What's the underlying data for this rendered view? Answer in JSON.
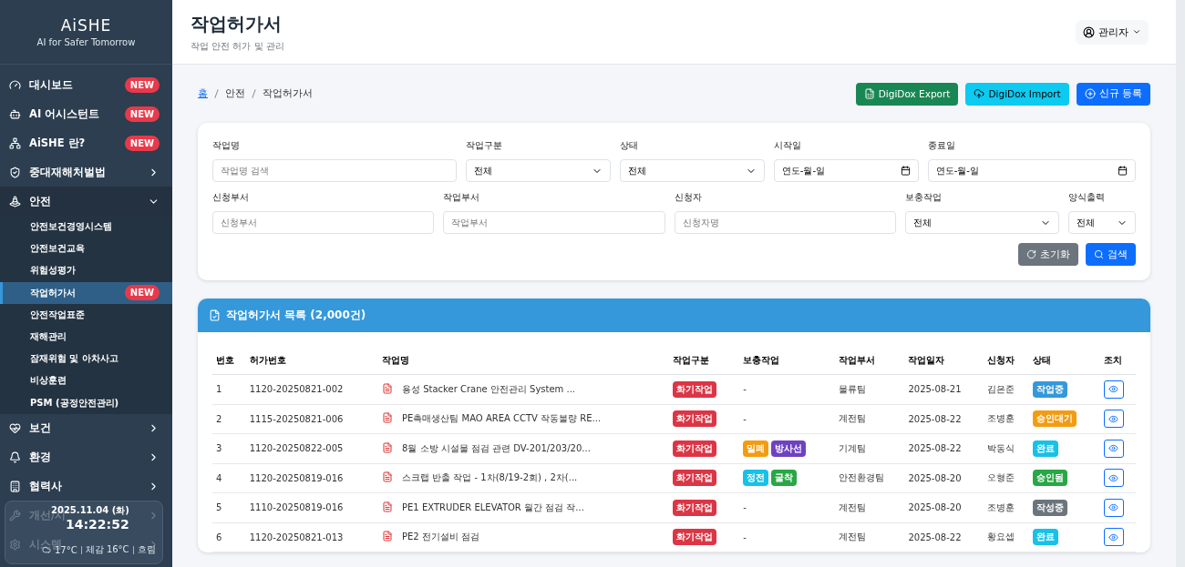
{
  "sidebar": {
    "logo": "AiSHE",
    "tagline": "AI for Safer Tomorrow",
    "items": [
      {
        "label": "대시보드",
        "badge": "NEW",
        "expanded": false
      },
      {
        "label": "AI 어시스턴트",
        "badge": "NEW",
        "expanded": false
      },
      {
        "label": "AiSHE 란?",
        "badge": "NEW",
        "expanded": false
      },
      {
        "label": "중대재해처벌법",
        "expanded": false
      },
      {
        "label": "안전",
        "expanded": true,
        "children": [
          {
            "label": "안전보건경영시스템",
            "selected": false
          },
          {
            "label": "안전보건교육",
            "selected": false
          },
          {
            "label": "위험성평가",
            "selected": false
          },
          {
            "label": "작업허가서",
            "selected": true,
            "badge": "NEW"
          },
          {
            "label": "안전작업표준",
            "selected": false
          },
          {
            "label": "재해관리",
            "selected": false
          },
          {
            "label": "잠재위험 및 아차사고",
            "selected": false
          },
          {
            "label": "비상훈련",
            "selected": false
          },
          {
            "label": "PSM (공정안전관리)",
            "selected": false
          }
        ]
      },
      {
        "label": "보건",
        "expanded": false
      },
      {
        "label": "환경",
        "expanded": false
      },
      {
        "label": "협력사",
        "expanded": false
      },
      {
        "label": "개선/시",
        "expanded": false
      },
      {
        "label": "시스템",
        "expanded": false
      }
    ],
    "widget": {
      "date": "2025.11.04 (화)",
      "time": "14:22:52",
      "weather": [
        "17°C",
        "체감 16°C",
        "흐림"
      ]
    }
  },
  "header": {
    "title": "작업허가서",
    "subtitle": "작업 안전 허가 및 관리",
    "user": "관리자"
  },
  "breadcrumb": [
    "홈",
    "안전",
    "작업허가서"
  ],
  "actions": [
    {
      "label": "DigiDox Export",
      "kind": "export"
    },
    {
      "label": "DigiDox Import",
      "kind": "import"
    },
    {
      "label": "신규 등록",
      "kind": "create"
    }
  ],
  "filters": [
    [
      {
        "label": "작업명",
        "kind": "text",
        "placeholder": "작업명 검색"
      },
      {
        "label": "작업구분",
        "kind": "select",
        "value": "전체"
      },
      {
        "label": "상태",
        "kind": "select",
        "value": "전체"
      },
      {
        "label": "시작일",
        "kind": "date",
        "value": "연도-월-일"
      },
      {
        "label": "종료일",
        "kind": "date",
        "value": "연도-월-일"
      }
    ],
    [
      {
        "label": "신청부서",
        "kind": "text",
        "placeholder": "신청부서"
      },
      {
        "label": "작업부서",
        "kind": "text",
        "placeholder": "작업부서"
      },
      {
        "label": "신청자",
        "kind": "text",
        "placeholder": "신청자명"
      },
      {
        "label": "보충작업",
        "kind": "select",
        "value": "전체"
      },
      {
        "label": "양식출력",
        "kind": "select",
        "value": "전체"
      }
    ]
  ],
  "filter_buttons": [
    {
      "label": "초기화",
      "kind": "reset"
    },
    {
      "label": "검색",
      "kind": "search"
    }
  ],
  "table": {
    "title": "작업허가서 목록 (2,000건)",
    "columns": [
      "번호",
      "허가번호",
      "작업명",
      "작업구분",
      "보충작업",
      "작업부서",
      "작업일자",
      "신청자",
      "상태",
      "조치"
    ],
    "rows": [
      {
        "no": "1",
        "permit": "1120-20250821-002",
        "name": "용성 Stacker Crane 안전관리 System ...",
        "type": {
          "label": "화기작업",
          "color": "#dc3545"
        },
        "extra": [],
        "extra_empty": "-",
        "dept": "물류팀",
        "date": "2025-08-21",
        "applicant": "김은준",
        "status": {
          "label": "작업중",
          "color": "#3498db"
        }
      },
      {
        "no": "2",
        "permit": "1115-20250821-006",
        "name": "PE촉매생산팀 MAO AREA CCTV 작동불량 RE...",
        "type": {
          "label": "화기작업",
          "color": "#dc3545"
        },
        "extra": [],
        "extra_empty": "-",
        "dept": "계전팀",
        "date": "2025-08-22",
        "applicant": "조병훈",
        "status": {
          "label": "승인대기",
          "color": "#f39c12"
        }
      },
      {
        "no": "3",
        "permit": "1120-20250822-005",
        "name": "8월 소방 시설물 점검 관련 DV-201/203/20...",
        "type": {
          "label": "화기작업",
          "color": "#dc3545"
        },
        "extra": [
          {
            "label": "밀폐",
            "color": "#f39c12"
          },
          {
            "label": "방사선",
            "color": "#6f42c1"
          }
        ],
        "dept": "기계팀",
        "date": "2025-08-22",
        "applicant": "박동식",
        "status": {
          "label": "완료",
          "color": "#17c1e8"
        }
      },
      {
        "no": "4",
        "permit": "1120-20250819-016",
        "name": "스크랩 반출 작업 - 1차(8/19-2회) , 2차(...",
        "type": {
          "label": "화기작업",
          "color": "#dc3545"
        },
        "extra": [
          {
            "label": "정전",
            "color": "#17c1e8"
          },
          {
            "label": "굴착",
            "color": "#28a745"
          }
        ],
        "dept": "안전환경팀",
        "date": "2025-08-20",
        "applicant": "오형준",
        "status": {
          "label": "승인됨",
          "color": "#28a745"
        }
      },
      {
        "no": "5",
        "permit": "1110-20250819-016",
        "name": "PE1 EXTRUDER ELEVATOR 월간 점검 작...",
        "type": {
          "label": "화기작업",
          "color": "#dc3545"
        },
        "extra": [],
        "extra_empty": "-",
        "dept": "계전팀",
        "date": "2025-08-20",
        "applicant": "조병훈",
        "status": {
          "label": "작성중",
          "color": "#6c757d"
        }
      },
      {
        "no": "6",
        "permit": "1120-20250821-013",
        "name": "PE2 전기설비 점검",
        "type": {
          "label": "화기작업",
          "color": "#dc3545"
        },
        "extra": [],
        "extra_empty": "-",
        "dept": "계전팀",
        "date": "2025-08-22",
        "applicant": "황요셉",
        "status": {
          "label": "완료",
          "color": "#17c1e8"
        }
      }
    ]
  }
}
